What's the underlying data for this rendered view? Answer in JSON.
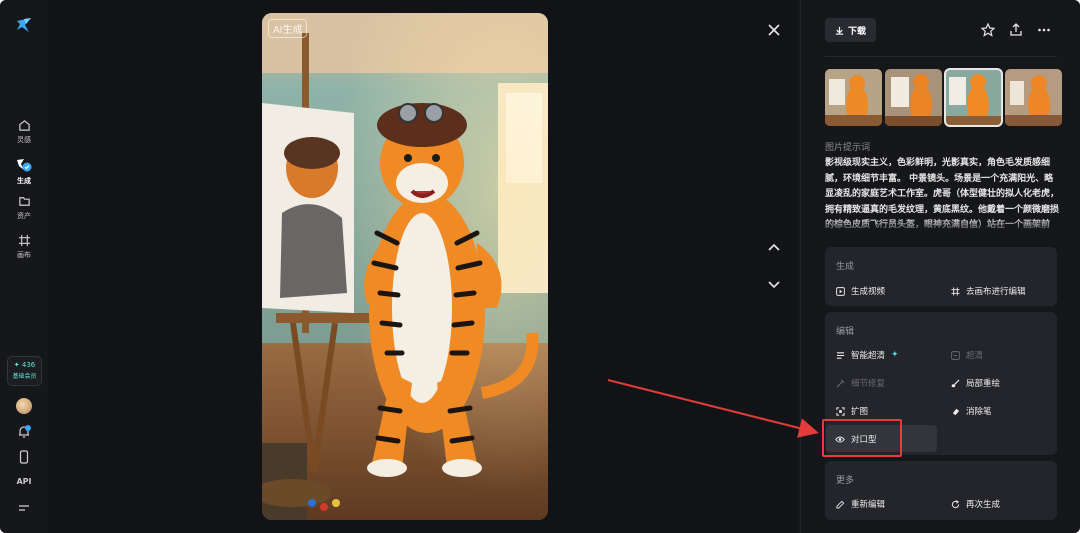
{
  "sidebar": {
    "items": [
      {
        "label": "灵感",
        "icon": "home-icon"
      },
      {
        "label": "生成",
        "icon": "generate-icon",
        "active": true
      },
      {
        "label": "资产",
        "icon": "folder-icon"
      },
      {
        "label": "画布",
        "icon": "canvas-icon"
      }
    ],
    "credits": {
      "value": "436",
      "tier": "基础会员"
    },
    "api_label": "API"
  },
  "viewer": {
    "ai_badge": "AI生成"
  },
  "panel": {
    "download_label": "下载",
    "prompt_title": "图片提示词",
    "prompt_text": "影视级现实主义，色彩鲜明，光影真实，角色毛发质感细腻，环境细节丰富。 中景镜头。场景是一个充满阳光、略显凌乱的家庭艺术工作室。虎哥（体型健壮的拟人化老虎，拥有精致逼真的毛发纹理，黄底黑纹。他戴着一个颜微磨损的棕色皮质飞行员头盔，眼神充满自信）站在一个画架前",
    "generate_section": {
      "title": "生成",
      "actions": [
        {
          "label": "生成视频",
          "icon": "play-icon"
        },
        {
          "label": "去画布进行编辑",
          "icon": "canvas-icon"
        }
      ]
    },
    "edit_section": {
      "title": "编辑",
      "actions": [
        {
          "label": "智能超清",
          "icon": "hd-icon"
        },
        {
          "label": "超清",
          "icon": "hd-icon",
          "disabled": true
        },
        {
          "label": "细节修复",
          "icon": "repair-icon",
          "disabled": true
        },
        {
          "label": "局部重绘",
          "icon": "brush-icon"
        },
        {
          "label": "扩图",
          "icon": "expand-icon"
        },
        {
          "label": "消除笔",
          "icon": "eraser-icon"
        },
        {
          "label": "对口型",
          "icon": "eye-icon"
        }
      ]
    },
    "more_section": {
      "title": "更多",
      "actions": [
        {
          "label": "重新编辑",
          "icon": "edit-icon"
        },
        {
          "label": "再次生成",
          "icon": "refresh-icon"
        }
      ]
    }
  },
  "colors": {
    "background": "#16171a",
    "accent": "#46d7f0",
    "annotation": "#e43b3b"
  }
}
